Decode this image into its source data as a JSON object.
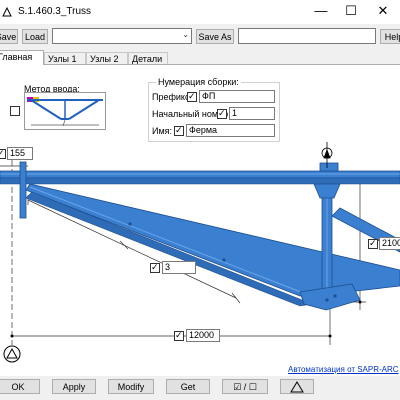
{
  "window": {
    "title": "S.1.460.3_Truss",
    "minimize": "—",
    "maximize": "☐",
    "close": "✕"
  },
  "toolbar": {
    "save_label": "Save",
    "load_label": "Load",
    "combo_value": "",
    "save_as_label": "Save As",
    "help_label": "Help"
  },
  "tabs": [
    {
      "label": "Главная"
    },
    {
      "label": "Узлы 1"
    },
    {
      "label": "Узлы 2"
    },
    {
      "label": "Детали"
    }
  ],
  "input_method": {
    "label": "Метод ввода:"
  },
  "assembly": {
    "title": "Нумерация сборки:",
    "prefix_label": "Префикс:",
    "prefix_value": "ФП",
    "start_label": "Начальный номер",
    "start_value": "1",
    "name_label": "Имя:",
    "name_value": "Ферма"
  },
  "dimensions": {
    "top_offset": "155",
    "height": "2100",
    "panels": "3",
    "span": "12000"
  },
  "colors": {
    "steel": "#3a7fd0",
    "steel_dark": "#1f4f8f",
    "link": "#0033cc"
  },
  "link_text": "Автоматизация от SAPR-ARC",
  "bottom": {
    "ok_label": "OK",
    "apply_label": "Apply",
    "modify_label": "Modify",
    "get_label": "Get",
    "toggle_label": "☑ / ☐",
    "warning_icon": "warning-triangle-icon"
  }
}
